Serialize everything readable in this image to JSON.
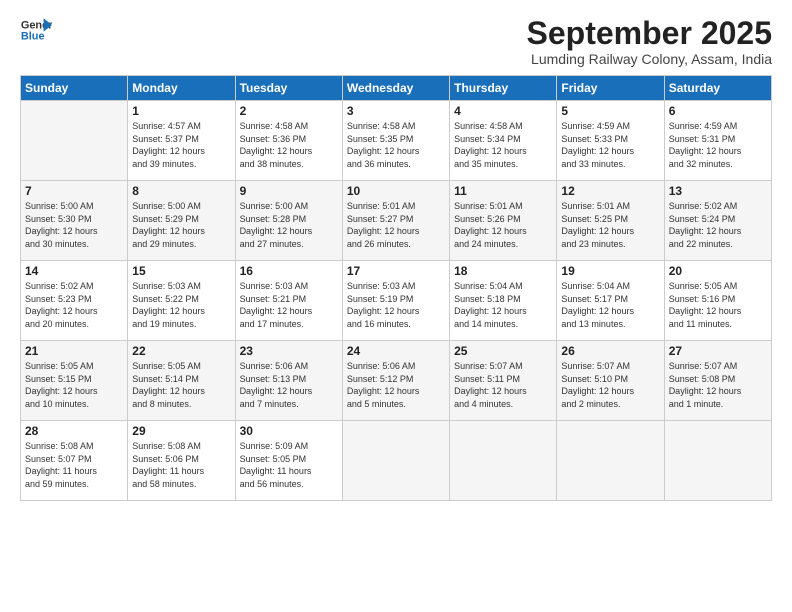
{
  "logo": {
    "line1": "General",
    "line2": "Blue"
  },
  "title": "September 2025",
  "subtitle": "Lumding Railway Colony, Assam, India",
  "days_header": [
    "Sunday",
    "Monday",
    "Tuesday",
    "Wednesday",
    "Thursday",
    "Friday",
    "Saturday"
  ],
  "weeks": [
    [
      {
        "num": "",
        "info": ""
      },
      {
        "num": "1",
        "info": "Sunrise: 4:57 AM\nSunset: 5:37 PM\nDaylight: 12 hours\nand 39 minutes."
      },
      {
        "num": "2",
        "info": "Sunrise: 4:58 AM\nSunset: 5:36 PM\nDaylight: 12 hours\nand 38 minutes."
      },
      {
        "num": "3",
        "info": "Sunrise: 4:58 AM\nSunset: 5:35 PM\nDaylight: 12 hours\nand 36 minutes."
      },
      {
        "num": "4",
        "info": "Sunrise: 4:58 AM\nSunset: 5:34 PM\nDaylight: 12 hours\nand 35 minutes."
      },
      {
        "num": "5",
        "info": "Sunrise: 4:59 AM\nSunset: 5:33 PM\nDaylight: 12 hours\nand 33 minutes."
      },
      {
        "num": "6",
        "info": "Sunrise: 4:59 AM\nSunset: 5:31 PM\nDaylight: 12 hours\nand 32 minutes."
      }
    ],
    [
      {
        "num": "7",
        "info": "Sunrise: 5:00 AM\nSunset: 5:30 PM\nDaylight: 12 hours\nand 30 minutes."
      },
      {
        "num": "8",
        "info": "Sunrise: 5:00 AM\nSunset: 5:29 PM\nDaylight: 12 hours\nand 29 minutes."
      },
      {
        "num": "9",
        "info": "Sunrise: 5:00 AM\nSunset: 5:28 PM\nDaylight: 12 hours\nand 27 minutes."
      },
      {
        "num": "10",
        "info": "Sunrise: 5:01 AM\nSunset: 5:27 PM\nDaylight: 12 hours\nand 26 minutes."
      },
      {
        "num": "11",
        "info": "Sunrise: 5:01 AM\nSunset: 5:26 PM\nDaylight: 12 hours\nand 24 minutes."
      },
      {
        "num": "12",
        "info": "Sunrise: 5:01 AM\nSunset: 5:25 PM\nDaylight: 12 hours\nand 23 minutes."
      },
      {
        "num": "13",
        "info": "Sunrise: 5:02 AM\nSunset: 5:24 PM\nDaylight: 12 hours\nand 22 minutes."
      }
    ],
    [
      {
        "num": "14",
        "info": "Sunrise: 5:02 AM\nSunset: 5:23 PM\nDaylight: 12 hours\nand 20 minutes."
      },
      {
        "num": "15",
        "info": "Sunrise: 5:03 AM\nSunset: 5:22 PM\nDaylight: 12 hours\nand 19 minutes."
      },
      {
        "num": "16",
        "info": "Sunrise: 5:03 AM\nSunset: 5:21 PM\nDaylight: 12 hours\nand 17 minutes."
      },
      {
        "num": "17",
        "info": "Sunrise: 5:03 AM\nSunset: 5:19 PM\nDaylight: 12 hours\nand 16 minutes."
      },
      {
        "num": "18",
        "info": "Sunrise: 5:04 AM\nSunset: 5:18 PM\nDaylight: 12 hours\nand 14 minutes."
      },
      {
        "num": "19",
        "info": "Sunrise: 5:04 AM\nSunset: 5:17 PM\nDaylight: 12 hours\nand 13 minutes."
      },
      {
        "num": "20",
        "info": "Sunrise: 5:05 AM\nSunset: 5:16 PM\nDaylight: 12 hours\nand 11 minutes."
      }
    ],
    [
      {
        "num": "21",
        "info": "Sunrise: 5:05 AM\nSunset: 5:15 PM\nDaylight: 12 hours\nand 10 minutes."
      },
      {
        "num": "22",
        "info": "Sunrise: 5:05 AM\nSunset: 5:14 PM\nDaylight: 12 hours\nand 8 minutes."
      },
      {
        "num": "23",
        "info": "Sunrise: 5:06 AM\nSunset: 5:13 PM\nDaylight: 12 hours\nand 7 minutes."
      },
      {
        "num": "24",
        "info": "Sunrise: 5:06 AM\nSunset: 5:12 PM\nDaylight: 12 hours\nand 5 minutes."
      },
      {
        "num": "25",
        "info": "Sunrise: 5:07 AM\nSunset: 5:11 PM\nDaylight: 12 hours\nand 4 minutes."
      },
      {
        "num": "26",
        "info": "Sunrise: 5:07 AM\nSunset: 5:10 PM\nDaylight: 12 hours\nand 2 minutes."
      },
      {
        "num": "27",
        "info": "Sunrise: 5:07 AM\nSunset: 5:08 PM\nDaylight: 12 hours\nand 1 minute."
      }
    ],
    [
      {
        "num": "28",
        "info": "Sunrise: 5:08 AM\nSunset: 5:07 PM\nDaylight: 11 hours\nand 59 minutes."
      },
      {
        "num": "29",
        "info": "Sunrise: 5:08 AM\nSunset: 5:06 PM\nDaylight: 11 hours\nand 58 minutes."
      },
      {
        "num": "30",
        "info": "Sunrise: 5:09 AM\nSunset: 5:05 PM\nDaylight: 11 hours\nand 56 minutes."
      },
      {
        "num": "",
        "info": ""
      },
      {
        "num": "",
        "info": ""
      },
      {
        "num": "",
        "info": ""
      },
      {
        "num": "",
        "info": ""
      }
    ]
  ]
}
